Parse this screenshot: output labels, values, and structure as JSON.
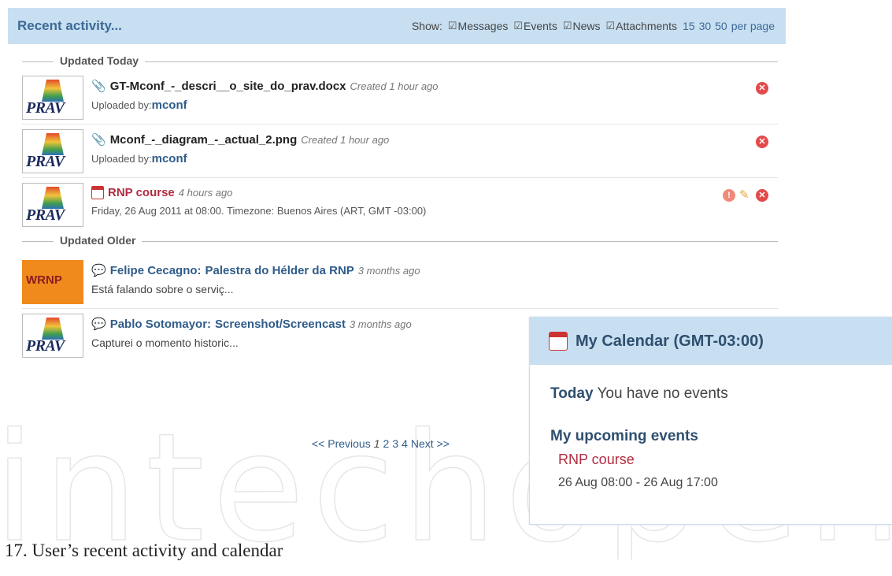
{
  "watermark": "intechopen",
  "activity": {
    "title": "Recent activity...",
    "show_label": "Show:",
    "filters": [
      {
        "label": "Messages",
        "checked": true
      },
      {
        "label": "Events",
        "checked": true
      },
      {
        "label": "News",
        "checked": true
      },
      {
        "label": "Attachments",
        "checked": true
      }
    ],
    "per_page_options": [
      "15",
      "30",
      "50"
    ],
    "per_page_suffix": "per page",
    "section_today": "Updated Today",
    "section_older": "Updated Older",
    "items_today": [
      {
        "thumb": "PRAV",
        "icon": "paperclip-icon",
        "name": "GT-Mconf_-_descri__o_site_do_prav.docx",
        "meta": "Created 1 hour ago",
        "line2_prefix": "Uploaded by:",
        "line2_user": "mconf",
        "actions": [
          "delete-icon"
        ]
      },
      {
        "thumb": "PRAV",
        "icon": "paperclip-icon",
        "name": "Mconf_-_diagram_-_actual_2.png",
        "meta": "Created 1 hour ago",
        "line2_prefix": "Uploaded by:",
        "line2_user": "mconf",
        "actions": [
          "delete-icon"
        ]
      },
      {
        "thumb": "PRAV",
        "icon": "calendar-icon",
        "name": "RNP course",
        "meta": "4 hours ago",
        "line2": "Friday, 26 Aug 2011 at 08:00. Timezone: Buenos Aires (ART, GMT -03:00)",
        "actions": [
          "info-icon",
          "pencil-icon",
          "delete-icon"
        ]
      }
    ],
    "items_older": [
      {
        "thumb": "WRNP",
        "icon": "comment-icon",
        "author": "Felipe Cecagno:",
        "title": "Palestra do Hélder da RNP",
        "meta": "3 months ago",
        "line2": "Está falando sobre o serviç..."
      },
      {
        "thumb": "PRAV",
        "icon": "comment-icon",
        "author": "Pablo Sotomayor:",
        "title": "Screenshot/Screencast",
        "meta": "3 months ago",
        "line2": "Capturei o momento historic..."
      }
    ],
    "pagination": {
      "prev": "<< Previous",
      "current": "1",
      "pages": [
        "2",
        "3",
        "4"
      ],
      "next": "Next >>"
    }
  },
  "calendar": {
    "title": "My Calendar (GMT-03:00)",
    "today_label": "Today",
    "today_text": "You have no events",
    "upcoming_label": "My upcoming events",
    "event_name": "RNP course",
    "event_range": "26 Aug 08:00 - 26 Aug 17:00"
  },
  "caption": "17. User’s recent activity and calendar",
  "colors": {
    "header_bg": "#c8dff1",
    "link_blue": "#2f5c8a",
    "event_red": "#b12c40"
  }
}
